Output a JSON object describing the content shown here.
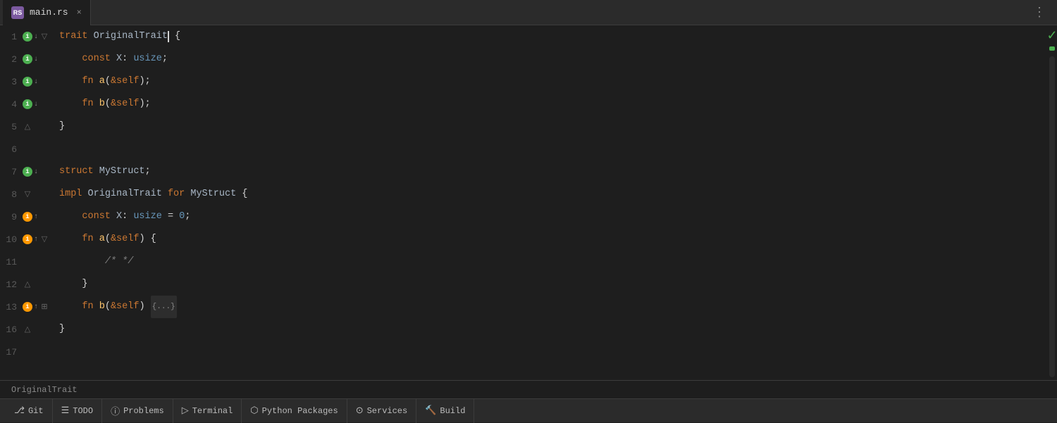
{
  "tab": {
    "icon_text": "RS",
    "filename": "main.rs",
    "close_label": "×"
  },
  "more_icon": "⋮",
  "check_icon": "✓",
  "code": {
    "lines": [
      {
        "num": 1,
        "gutter": {
          "fold": "▽",
          "indicator": {
            "type": "green-down",
            "label": "i↓"
          }
        },
        "tokens": [
          {
            "t": "kw",
            "v": "trait "
          },
          {
            "t": "trait-name",
            "v": "OriginalTrait"
          },
          {
            "t": "cursor",
            "v": ""
          },
          {
            "t": "punct",
            "v": " {"
          }
        ]
      },
      {
        "num": 2,
        "gutter": {
          "fold": "",
          "indicator": {
            "type": "green-down",
            "label": "i↓"
          },
          "bulb": true
        },
        "tokens": [
          {
            "t": "plain",
            "v": "    "
          },
          {
            "t": "kw",
            "v": "const "
          },
          {
            "t": "type-name",
            "v": "X"
          },
          {
            "t": "punct",
            "v": ": "
          },
          {
            "t": "type-ref",
            "v": "usize"
          },
          {
            "t": "punct",
            "v": ";"
          }
        ]
      },
      {
        "num": 3,
        "gutter": {
          "fold": "",
          "indicator": {
            "type": "green-down",
            "label": "i↓"
          }
        },
        "tokens": [
          {
            "t": "plain",
            "v": "    "
          },
          {
            "t": "kw",
            "v": "fn "
          },
          {
            "t": "fn-name",
            "v": "a"
          },
          {
            "t": "punct",
            "v": "("
          },
          {
            "t": "amp",
            "v": "&"
          },
          {
            "t": "self-kw",
            "v": "self"
          },
          {
            "t": "punct",
            "v": ");"
          }
        ]
      },
      {
        "num": 4,
        "gutter": {
          "fold": "",
          "indicator": {
            "type": "green-down",
            "label": "i↓"
          }
        },
        "tokens": [
          {
            "t": "plain",
            "v": "    "
          },
          {
            "t": "kw",
            "v": "fn "
          },
          {
            "t": "fn-name",
            "v": "b"
          },
          {
            "t": "punct",
            "v": "("
          },
          {
            "t": "amp",
            "v": "&"
          },
          {
            "t": "self-kw",
            "v": "self"
          },
          {
            "t": "punct",
            "v": ");"
          }
        ]
      },
      {
        "num": 5,
        "gutter": {
          "fold": "△",
          "indicator": null
        },
        "tokens": [
          {
            "t": "punct",
            "v": "}"
          }
        ]
      },
      {
        "num": 6,
        "gutter": {
          "fold": "",
          "indicator": null
        },
        "tokens": []
      },
      {
        "num": 7,
        "gutter": {
          "fold": "",
          "indicator": {
            "type": "green-down",
            "label": "i↓"
          }
        },
        "tokens": [
          {
            "t": "kw",
            "v": "struct "
          },
          {
            "t": "struct-name",
            "v": "MyStruct"
          },
          {
            "t": "punct",
            "v": ";"
          }
        ]
      },
      {
        "num": 8,
        "gutter": {
          "fold": "▽",
          "indicator": null
        },
        "tokens": [
          {
            "t": "kw",
            "v": "impl "
          },
          {
            "t": "trait-name",
            "v": "OriginalTrait"
          },
          {
            "t": "kw",
            "v": " for "
          },
          {
            "t": "struct-name",
            "v": "MyStruct"
          },
          {
            "t": "punct",
            "v": " {"
          }
        ]
      },
      {
        "num": 9,
        "gutter": {
          "fold": "",
          "indicator": {
            "type": "orange-up",
            "label": "i↑"
          }
        },
        "tokens": [
          {
            "t": "plain",
            "v": "    "
          },
          {
            "t": "kw",
            "v": "const "
          },
          {
            "t": "type-name",
            "v": "X"
          },
          {
            "t": "punct",
            "v": ": "
          },
          {
            "t": "type-ref",
            "v": "usize"
          },
          {
            "t": "punct",
            "v": " = "
          },
          {
            "t": "number",
            "v": "0"
          },
          {
            "t": "punct",
            "v": ";"
          }
        ]
      },
      {
        "num": 10,
        "gutter": {
          "fold": "▽",
          "indicator": {
            "type": "orange-up",
            "label": "i↑"
          }
        },
        "tokens": [
          {
            "t": "plain",
            "v": "    "
          },
          {
            "t": "kw",
            "v": "fn "
          },
          {
            "t": "fn-name",
            "v": "a"
          },
          {
            "t": "punct",
            "v": "("
          },
          {
            "t": "amp",
            "v": "&"
          },
          {
            "t": "self-kw",
            "v": "self"
          },
          {
            "t": "punct",
            "v": ") {"
          }
        ]
      },
      {
        "num": 11,
        "gutter": {
          "fold": "",
          "indicator": null
        },
        "tokens": [
          {
            "t": "plain",
            "v": "        "
          },
          {
            "t": "comment",
            "v": "/* */"
          }
        ]
      },
      {
        "num": 12,
        "gutter": {
          "fold": "△",
          "indicator": null
        },
        "tokens": [
          {
            "t": "plain",
            "v": "    "
          },
          {
            "t": "punct",
            "v": "}"
          }
        ]
      },
      {
        "num": 13,
        "gutter": {
          "fold": "",
          "indicator": {
            "type": "orange-up",
            "label": "i↑"
          },
          "fold_plus": true
        },
        "tokens": [
          {
            "t": "plain",
            "v": "    "
          },
          {
            "t": "kw",
            "v": "fn "
          },
          {
            "t": "fn-name",
            "v": "b"
          },
          {
            "t": "punct",
            "v": "("
          },
          {
            "t": "amp",
            "v": "&"
          },
          {
            "t": "self-kw",
            "v": "self"
          },
          {
            "t": "punct",
            "v": ") "
          },
          {
            "t": "fold-marker",
            "v": "{...}"
          }
        ]
      },
      {
        "num": 16,
        "gutter": {
          "fold": "△",
          "indicator": null
        },
        "tokens": [
          {
            "t": "punct",
            "v": "}"
          }
        ]
      },
      {
        "num": 17,
        "gutter": {
          "fold": "",
          "indicator": null
        },
        "tokens": []
      }
    ]
  },
  "breadcrumb": {
    "text": "OriginalTrait"
  },
  "status_bar": {
    "items": [
      {
        "icon": "⎇",
        "label": "Git",
        "name": "git"
      },
      {
        "icon": "☰",
        "label": "TODO",
        "name": "todo"
      },
      {
        "icon": "ⓘ",
        "label": "Problems",
        "name": "problems"
      },
      {
        "icon": "▷",
        "label": "Terminal",
        "name": "terminal"
      },
      {
        "icon": "⬡",
        "label": "Python Packages",
        "name": "python-packages"
      },
      {
        "icon": "⊙",
        "label": "Services",
        "name": "services"
      },
      {
        "icon": "🔨",
        "label": "Build",
        "name": "build"
      }
    ]
  }
}
